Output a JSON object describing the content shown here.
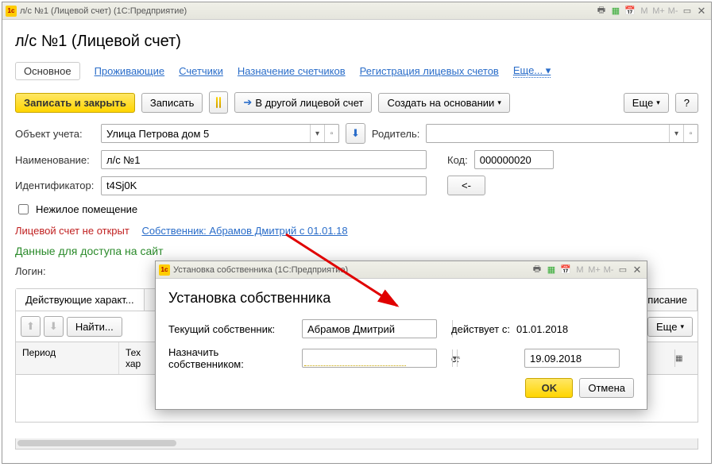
{
  "main": {
    "title": "л/с №1 (Лицевой счет)  (1С:Предприятие)",
    "pageTitle": "л/с №1 (Лицевой счет)",
    "tabs": {
      "main": "Основное",
      "residents": "Проживающие",
      "counters": "Счетчики",
      "assign": "Назначение счетчиков",
      "register": "Регистрация лицевых счетов",
      "more": "Еще..."
    },
    "toolbar": {
      "saveClose": "Записать и закрыть",
      "save": "Записать",
      "transfer": "В другой лицевой счет",
      "createBased": "Создать на основании",
      "more": "Еще",
      "help": "?"
    },
    "fields": {
      "objectLabel": "Объект учета:",
      "objectValue": "Улица Петрова дом 5",
      "parentLabel": "Родитель:",
      "nameLabel": "Наименование:",
      "nameValue": "л/с №1",
      "codeLabel": "Код:",
      "codeValue": "000000020",
      "idLabel": "Идентификатор:",
      "idValue": "t4Sj0K",
      "idBtn": "<-",
      "nonResidential": "Нежилое помещение",
      "statusNotOpen": "Лицевой счет не открыт",
      "ownerLink": "Собственник: Абрамов Дмитрий с 01.01.18",
      "siteSection": "Данные для доступа на сайт",
      "loginLabel": "Логин:"
    },
    "subtabs": {
      "active": "Действующие характ...",
      "desc": "писание"
    },
    "subtoolbar": {
      "find": "Найти...",
      "more": "Еще"
    },
    "table": {
      "period": "Период",
      "tech": "Тех\nхар"
    }
  },
  "dialog": {
    "title": "Установка собственника  (1С:Предприятие)",
    "pageTitle": "Установка собственника",
    "currentOwnerLabel": "Текущий собственник:",
    "currentOwnerValue": "Абрамов Дмитрий",
    "effectiveLabel": "действует с:",
    "effectiveValue": "01.01.2018",
    "assignLabel": "Назначить собственником:",
    "assignValue": "",
    "fromLabel": "с:",
    "fromValue": "19.09.2018",
    "ok": "OK",
    "cancel": "Отмена"
  }
}
